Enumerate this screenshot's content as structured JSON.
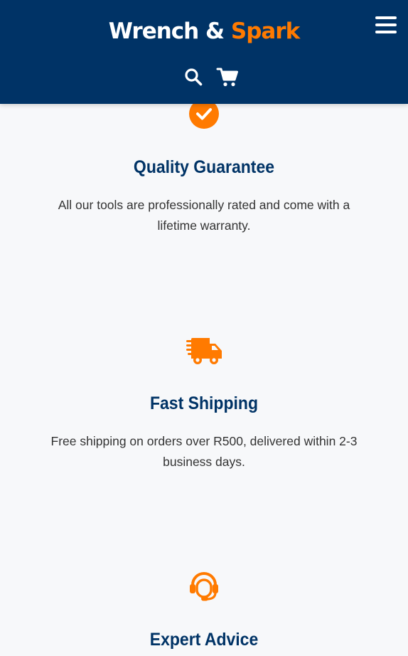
{
  "header": {
    "logo_part1": "Wrench & ",
    "logo_part2": "Spark",
    "menu_icon": "hamburger-menu-icon",
    "search_icon": "search-icon",
    "cart_icon": "shopping-cart-icon"
  },
  "features": [
    {
      "icon": "check-circle-icon",
      "title": "Quality Guarantee",
      "text": "All our tools are professionally rated and come with a lifetime warranty."
    },
    {
      "icon": "shipping-truck-icon",
      "title": "Fast Shipping",
      "text": "Free shipping on orders over R500, delivered within 2-3 business days."
    },
    {
      "icon": "headset-icon",
      "title": "Expert Advice",
      "text": ""
    }
  ],
  "colors": {
    "primary": "#003366",
    "accent": "#ff7a00",
    "background": "#f7f8fa",
    "text": "#333333"
  }
}
